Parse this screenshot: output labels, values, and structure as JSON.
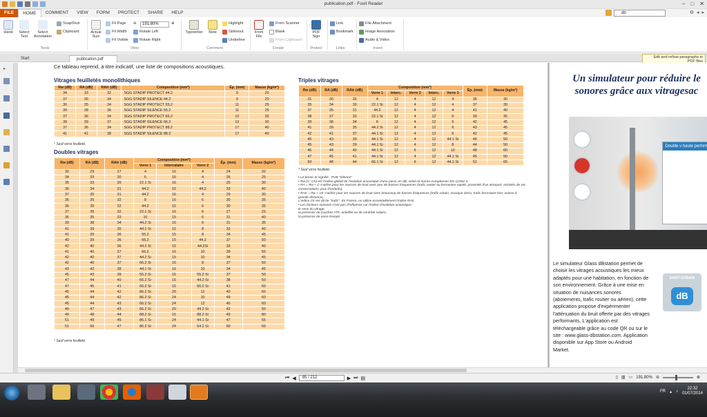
{
  "window": {
    "title": "publication.pdf - Foxit Reader"
  },
  "menu": {
    "tabs": [
      "FILE",
      "HOME",
      "COMMENT",
      "VIEW",
      "FORM",
      "PROTECT",
      "SHARE",
      "HELP"
    ],
    "search_value": "db"
  },
  "ribbon": {
    "hand": "Hand",
    "select_text": "Select Text",
    "select_annotation": "Select Annotation",
    "snapshot": "SnapShot",
    "clipboard": "Clipboard",
    "actual_size": "Actual Size",
    "fit_page": "Fit Page",
    "fit_width": "Fit Width",
    "fit_visible": "Fit Visible",
    "zoom": "191.80%",
    "rotate_left": "Rotate Left",
    "rotate_right": "Rotate Right",
    "typewriter": "Typewriter",
    "note": "Note",
    "highlight": "Highlight",
    "strikeout": "Strikeout",
    "underline": "Underline",
    "from_file": "From File",
    "from_scanner": "From Scanner",
    "blank": "Blank",
    "from_clipboard": "From Clipboard",
    "pdf_sign": "PDF Sign",
    "link": "Link",
    "bookmark": "Bookmark",
    "file_attachment": "File Attachment",
    "image_annotation": "Image Annotation",
    "audio_video": "Audio & Video",
    "groups": {
      "tools": "Tools",
      "view": "View",
      "comment": "Comment",
      "create": "Create",
      "protect": "Protect",
      "links": "Links",
      "insert": "Insert"
    }
  },
  "doctabs": {
    "start": "Start",
    "file": "publication.pdf",
    "tip": "Edit and reflow paragraphs in PDF files"
  },
  "page": {
    "intro": "Ce tableau reprend, à titre indicatif, une liste de compositions acoustiques.",
    "mono_title": "Vitrages feuilletés monolithiques",
    "mono_headers": [
      "Rw (dB)",
      "RA (dB)",
      "RAtr (dB)",
      "Composition (mm*)",
      "Ép. (mm)",
      "Masse (kg/m²)"
    ],
    "mono_rows": [
      [
        "34",
        "33",
        "32",
        "SGG STADIP PROTECT 44.2",
        "9",
        "20"
      ],
      [
        "37",
        "36",
        "34",
        "SGG STADIP SILENCE 44.2",
        "9",
        "20"
      ],
      [
        "36",
        "35",
        "34",
        "SGG STADIP PROTECT 55.2",
        "11",
        "25"
      ],
      [
        "39",
        "38",
        "36",
        "SGG STADIP SILENCE 55.2",
        "11",
        "25"
      ],
      [
        "37",
        "36",
        "34",
        "SGG STADIP PROTECT 66.2",
        "13",
        "30"
      ],
      [
        "39",
        "39",
        "37",
        "SGG STADIP SILENCE 66.2",
        "13",
        "30"
      ],
      [
        "37",
        "36",
        "34",
        "SGG STADIP PROTECT 88.2",
        "17",
        "40"
      ],
      [
        "41",
        "41",
        "38",
        "SGG STADIP SILENCE 88.2",
        "17",
        "40"
      ]
    ],
    "mono_note": "* Sauf verre feuilleté.",
    "double_title": "Doubles vitrages",
    "double_headers": [
      "Rw (dB)",
      "RA (dB)",
      "RAtr (dB)",
      "Composition (mm*)",
      "Ép. (mm)",
      "Masse (kg/m²)"
    ],
    "double_sub": [
      "Verre 1",
      "Intercalaire",
      "Verre 2"
    ],
    "double_rows": [
      [
        "30",
        "29",
        "27",
        "4",
        "16",
        "4",
        "24",
        "20"
      ],
      [
        "34",
        "33",
        "30",
        "6",
        "16",
        "4",
        "26",
        "25"
      ],
      [
        "35",
        "33",
        "30",
        "22.1 Si",
        "16",
        "4",
        "25",
        "30"
      ],
      [
        "36",
        "34",
        "31",
        "44.2",
        "15",
        "44.2",
        "33",
        "40"
      ],
      [
        "37",
        "35",
        "31",
        "44.2",
        "16",
        "4",
        "29",
        "30"
      ],
      [
        "36",
        "35",
        "32",
        "8",
        "16",
        "6",
        "30",
        "35"
      ],
      [
        "36",
        "35",
        "32",
        "44.2",
        "15",
        "6",
        "30",
        "35"
      ],
      [
        "37",
        "36",
        "32",
        "22.1 Si",
        "16",
        "6",
        "27",
        "25"
      ],
      [
        "36",
        "35",
        "33",
        "10",
        "15",
        "6",
        "31",
        "40"
      ],
      [
        "39",
        "38",
        "34",
        "44.2 Si",
        "16",
        "6",
        "31",
        "35"
      ],
      [
        "41",
        "39",
        "35",
        "44.2 Si",
        "15",
        "8",
        "32",
        "40"
      ],
      [
        "41",
        "39",
        "36",
        "55.2",
        "15",
        "8",
        "34",
        "45"
      ],
      [
        "40",
        "39",
        "36",
        "66.2",
        "15",
        "44.2",
        "37",
        "50"
      ],
      [
        "42",
        "40",
        "36",
        "44.2 Si",
        "15",
        "44.2Si",
        "33",
        "40"
      ],
      [
        "41",
        "40",
        "37",
        "66.2",
        "16",
        "10",
        "39",
        "55"
      ],
      [
        "42",
        "40",
        "37",
        "44.2 Si",
        "15",
        "10",
        "34",
        "45"
      ],
      [
        "42",
        "40",
        "37",
        "66.2 Si",
        "16",
        "8",
        "37",
        "50"
      ],
      [
        "43",
        "42",
        "38",
        "44.1 Si",
        "16",
        "10",
        "34",
        "45"
      ],
      [
        "45",
        "43",
        "39",
        "55.2 Si",
        "15",
        "55.2 Si",
        "37",
        "50"
      ],
      [
        "47",
        "44",
        "40",
        "66.2 Si",
        "16",
        "44.2 Si",
        "38",
        "50"
      ],
      [
        "47",
        "45",
        "41",
        "66.2 Si",
        "15",
        "66.2 Si",
        "41",
        "60"
      ],
      [
        "45",
        "44",
        "42",
        "86.2 Si",
        "20",
        "12",
        "40",
        "60"
      ],
      [
        "45",
        "44",
        "42",
        "86.2 Si",
        "24",
        "10",
        "49",
        "60"
      ],
      [
        "45",
        "44",
        "43",
        "66.2 Si",
        "24",
        "12",
        "40",
        "60"
      ],
      [
        "49",
        "47",
        "43",
        "66.2 Si",
        "20",
        "44.2 Si",
        "42",
        "50"
      ],
      [
        "49",
        "48",
        "44",
        "88.2 Si",
        "15",
        "88.2 Si",
        "49",
        "80"
      ],
      [
        "51",
        "49",
        "45",
        "86.1 Si",
        "24",
        "44.1 Si",
        "47",
        "55"
      ],
      [
        "51",
        "50",
        "47",
        "86.2 Si",
        "24",
        "64.2 Si",
        "50",
        "60"
      ]
    ],
    "double_note": "* Sauf verre feuilleté.",
    "triple_title": "Triples vitrages",
    "triple_headers": [
      "Rw (dB)",
      "RA (dB)",
      "RAtr (dB)",
      "Composition (mm*)",
      "Ép. (mm)",
      "Masse (kg/m²)"
    ],
    "triple_sub": [
      "Verre 1",
      "Interc.",
      "Verre 2",
      "Interc.",
      "Verre 3"
    ],
    "triple_rows": [
      [
        "31",
        "30",
        "26",
        "4",
        "12",
        "4",
        "12",
        "4",
        "36",
        "30"
      ],
      [
        "35",
        "34",
        "30",
        "22.1 Si",
        "12",
        "4",
        "12",
        "4",
        "37",
        "30"
      ],
      [
        "37",
        "35",
        "31",
        "44.2",
        "12",
        "4",
        "12",
        "4",
        "41",
        "40"
      ],
      [
        "38",
        "37",
        "32",
        "22.1 Si",
        "12",
        "4",
        "12",
        "6",
        "39",
        "35"
      ],
      [
        "39",
        "38",
        "34",
        "8",
        "12",
        "4",
        "12",
        "6",
        "42",
        "45"
      ],
      [
        "41",
        "39",
        "35",
        "44.2 Si",
        "12",
        "4",
        "12",
        "6",
        "43",
        "45"
      ],
      [
        "42",
        "41",
        "37",
        "44.1 Si",
        "12",
        "4",
        "12",
        "6",
        "42",
        "45"
      ],
      [
        "45",
        "43",
        "39",
        "44.1 Si",
        "12",
        "4",
        "12",
        "44.1 Si",
        "46",
        "50"
      ],
      [
        "45",
        "43",
        "39",
        "44.1 Si",
        "12",
        "4",
        "12",
        "8",
        "44",
        "50"
      ],
      [
        "46",
        "44",
        "40",
        "44.1 Si",
        "12",
        "6",
        "12",
        "10",
        "48",
        "60"
      ],
      [
        "47",
        "45",
        "41",
        "44.1 Si",
        "12",
        "4",
        "12",
        "44.1 Si",
        "45",
        "50"
      ],
      [
        "50",
        "48",
        "44",
        "66.1 Si",
        "12",
        "6",
        "12",
        "44.1 Si",
        "51",
        "65"
      ]
    ],
    "triple_note": "* Sauf verre feuilleté.",
    "notes": [
      "• Le terme Si signifie : PVB \"Silence\"",
      "• Rw (C; Ctr) est l'indice global de l'isolation acoustique d'une paroi, en dB, selon la norme européenne EN 12354-3.",
      "• RA = Rw + C s'utilise pour les sources de bruit avec peu de basses fréquences (trafic routier ou ferroviaire rapide, proximité d'un aéroport, activités de vie, conversations, jeux d'enfants).",
      "• RAtr = Rw + Ctr s'utilise pour les sources de bruit avec beaucoup de basses fréquences (trafic urbain, musique disco, trafic ferroviaire lent, avions à grande distance).",
      "L'indice Ctr est dit de \"trafic\". En France, on utilise essentiellement l'indice RAtr",
      "• Les facteurs suivants n'ont pas d'influence sur l'indice d'isolation acoustique :",
      "le sens du vitrage,",
      "la présence de couches ITR, antieffet ou de contrôle solaire,",
      "la présence de verre trempé."
    ],
    "right_title": "Un simulateur pour réduire le sonores grâce aux vitragesac",
    "promo_header": "Double v haute performe",
    "right_body": "Le simulateur Glass dBstation permet de choisir les vitrages acoustiques les mieux adaptés pour une habitation, en fonction de son environnement. Grâce à une mise en situation de nuisances sonores (aboiements, trafic routier ou aérien), cette application propose d'expérimenter l'atténuation du bruit offerte par des vitrages performants. L'application est téléchargeable grâce au code QR ou sur le site : www.glass-dbstation.com. Application disponible sur App Store ou Android Market.",
    "logo_brand": "SAINT-GOBAIN",
    "logo_db": "dB"
  },
  "status": {
    "page": "85 / 212",
    "zoom": "191.80%"
  },
  "taskbar": {
    "lang": "FR",
    "time": "22:32",
    "date": "01/07/2014"
  },
  "colors": {
    "accent": "#d35400",
    "table_cell": "#fcd9a8",
    "table_header": "#f7b56a",
    "title_blue": "#1d2f5c"
  }
}
